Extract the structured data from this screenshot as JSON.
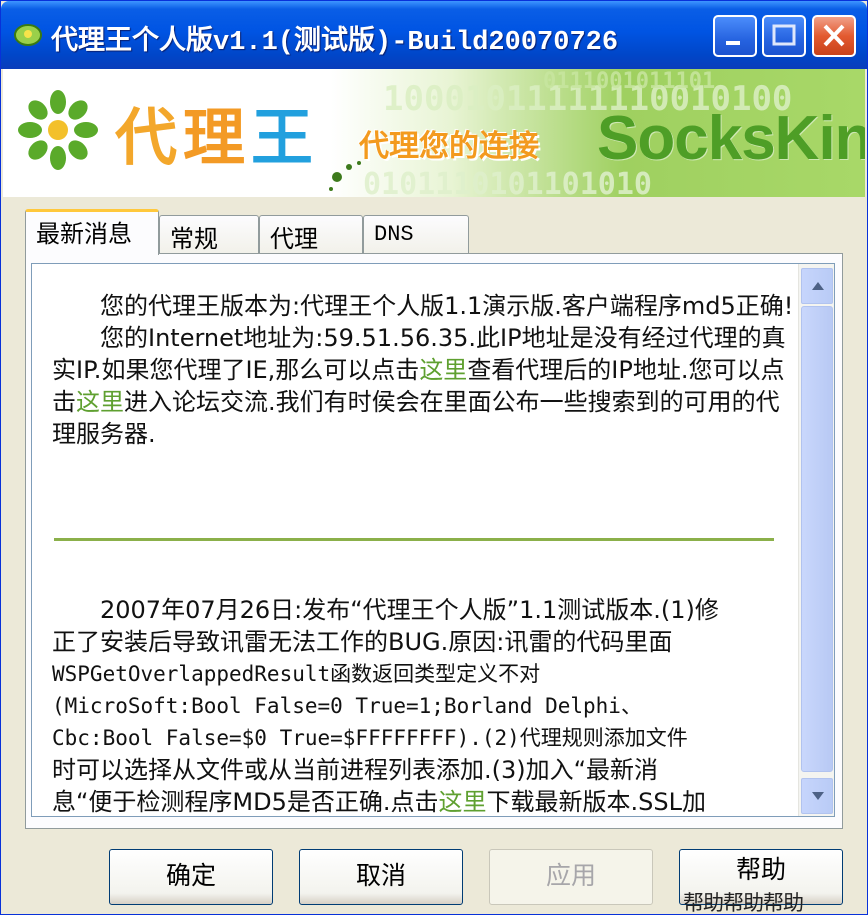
{
  "window": {
    "title": "代理王个人版v1.1(测试版)-Build20070726",
    "controls": {
      "minimize": "minimize",
      "maximize": "maximize",
      "close": "close"
    }
  },
  "banner": {
    "brand_chars": [
      "代",
      "理",
      "王"
    ],
    "slogan": "代理您的连接",
    "product": "SocksKing",
    "binary_text_1": "10001011111110010100",
    "binary_text_2": "0101110101101010",
    "binary_text_3": "0111001011101"
  },
  "tabs": [
    {
      "label": "最新消息",
      "active": true
    },
    {
      "label": "常规",
      "active": false
    },
    {
      "label": "代理",
      "active": false
    },
    {
      "label": "DNS",
      "active": false
    }
  ],
  "message": {
    "p1": "您的代理王版本为:代理王个人版1.1演示版.客户端程序md5正确!",
    "p2_before_link": "您的Internet地址为:59.51.56.35.此IP地址是没有经过代理的真实IP.如果您代理了IE,那么可以点击",
    "link_here": "这里",
    "p2_mid": "查看代理后的IP地址.您可以点击",
    "p2_after_link": "进入论坛交流.我们有时侯会在里面公布一些搜索到的可用的代理服务器.",
    "news_l1": "2007年07月26日:发布“代理王个人版”1.1测试版本.(1)修",
    "news_l2": "正了安装后导致讯雷无法工作的BUG.原因:讯雷的代码里面",
    "news_l3": "WSPGetOverlappedResult函数返回类型定义不对",
    "news_l4": "(MicroSoft:Bool False=0 True=1;Borland Delphi、",
    "news_l5": "Cbc:Bool False=$0 True=$FFFFFFFF).(2)代理规则添加文件",
    "news_l6": "时可以选择从文件或从当前进程列表添加.(3)加入“最新消",
    "news_l7_before_link": "息“便于检测程序MD5是否正确.点击",
    "news_l7_after_link": "下载最新版本.SSL加"
  },
  "buttons": {
    "ok": "确定",
    "cancel": "取消",
    "apply": "应用",
    "help": "帮助",
    "help_ghost": "帮助帮助帮助"
  },
  "colors": {
    "titlebar": "#0054e3",
    "link": "#5fa030",
    "divider": "#8bb04a",
    "brand_orange": "#f3a72b",
    "brand_blue": "#22a0de",
    "product_green": "#4e9e26"
  }
}
